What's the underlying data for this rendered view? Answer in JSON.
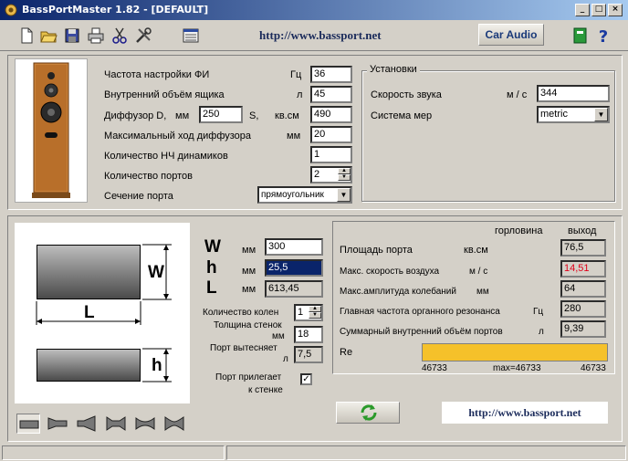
{
  "window": {
    "title": "BassPortMaster 1.82  - [DEFAULT]",
    "controls": [
      "_",
      "□",
      "×"
    ]
  },
  "toolbar": {
    "icons": [
      "new-file-icon",
      "open-folder-icon",
      "save-icon",
      "print-icon",
      "cut-icon",
      "tools-icon",
      "calculator-icon"
    ],
    "url": "http://www.bassport.net",
    "car_audio_label": "Car Audio",
    "right_icons": [
      "book-icon",
      "help-icon"
    ]
  },
  "speaker_params": {
    "tuning_freq": {
      "label": "Частота настройки ФИ",
      "unit": "Гц",
      "value": "36"
    },
    "box_volume": {
      "label": "Внутренний объём ящика",
      "unit": "л",
      "value": "45"
    },
    "diffuser": {
      "label": "Диффузор D,",
      "unit_d": "мм",
      "value_d": "250",
      "unit_s_prefix": "S,",
      "unit_s": "кв.см",
      "value_s": "490"
    },
    "max_excursion": {
      "label": "Максимальный ход диффузора",
      "unit": "мм",
      "value": "20"
    },
    "driver_count": {
      "label": "Количество НЧ динамиков",
      "value": "1"
    },
    "port_count": {
      "label": "Количество портов",
      "value": "2"
    },
    "port_section": {
      "label": "Сечение порта",
      "value": "прямоугольник"
    }
  },
  "settings": {
    "title": "Установки",
    "sound_speed": {
      "label": "Скорость звука",
      "unit": "м / с",
      "value": "344"
    },
    "units_system": {
      "label": "Система мер",
      "value": "metric"
    }
  },
  "port_dims": {
    "w": {
      "letter": "W",
      "unit": "мм",
      "value": "300"
    },
    "h": {
      "letter": "h",
      "unit": "мм",
      "value": "25,5"
    },
    "l": {
      "letter": "L",
      "unit": "мм",
      "value": "613,45"
    },
    "bends": {
      "label": "Количество колен",
      "value": "1"
    },
    "wall_thickness": {
      "label": "Толщина стенок",
      "unit": "мм",
      "value": "18"
    },
    "port_displacement": {
      "label": "Порт вытесняет",
      "unit": "л",
      "value": "7,5"
    },
    "port_adjacent": {
      "label_1": "Порт прилегает",
      "label_2": "к стенке",
      "checked": true
    }
  },
  "diagram": {
    "w_label": "W",
    "l_label": "L",
    "h_label": "h"
  },
  "results": {
    "col_throat": "горловина",
    "col_exit": "выход",
    "port_area": {
      "label": "Площадь порта",
      "unit": "кв.см",
      "value": "76,5"
    },
    "max_air_speed": {
      "label": "Макс. скорость воздуха",
      "unit": "м / с",
      "value": "14,51"
    },
    "max_amplitude": {
      "label": "Макс.амплитуда колебаний",
      "unit": "мм",
      "value": "64"
    },
    "organ_resonance": {
      "label": "Главная частота органного резонанса",
      "unit": "Гц",
      "value": "280"
    },
    "ports_volume": {
      "label": "Суммарный внутренний объём портов",
      "unit": "л",
      "value": "9,39"
    },
    "re": {
      "label": "Re",
      "left": "46733",
      "mid": "max=46733",
      "right": "46733",
      "fill": 1.0,
      "color": "#f5c12a"
    }
  },
  "bottom": {
    "url": "http://www.bassport.net",
    "shape_icons": [
      "straight-port-icon",
      "flared-one-end-port-icon",
      "horn-port-icon",
      "flared-both-ends-port-icon",
      "bell-port-icon",
      "double-flare-port-icon"
    ]
  },
  "colors": {
    "title_start": "#0a246a",
    "title_end": "#a6caf0",
    "warning_value": "#e0001a",
    "re_bar": "#f5c12a",
    "refresh_green": "#2a9a2a"
  }
}
